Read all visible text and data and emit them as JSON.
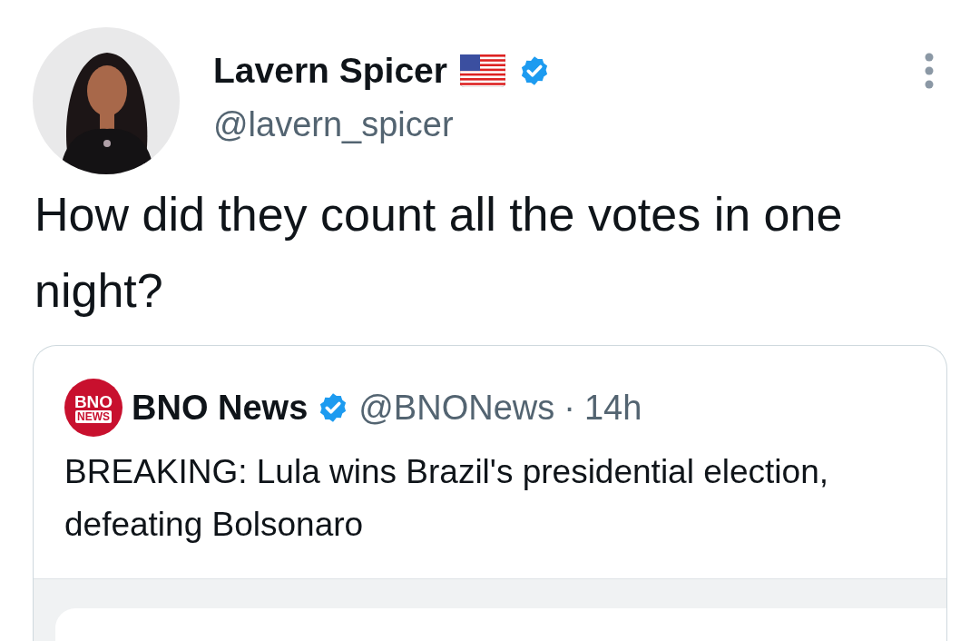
{
  "tweet": {
    "author": {
      "name": "Lavern Spicer",
      "handle": "@lavern_spicer",
      "verified": true
    },
    "text": "How did they count all the votes in one night?"
  },
  "quoted": {
    "logo": {
      "line_1": "BNO",
      "line_2": "NEWS"
    },
    "name": "BNO News",
    "verified": true,
    "handle": "@BNONews",
    "separator": "·",
    "time": "14h",
    "text": "BREAKING: Lula wins Brazil's presidential election, defeating Bolsonaro"
  }
}
